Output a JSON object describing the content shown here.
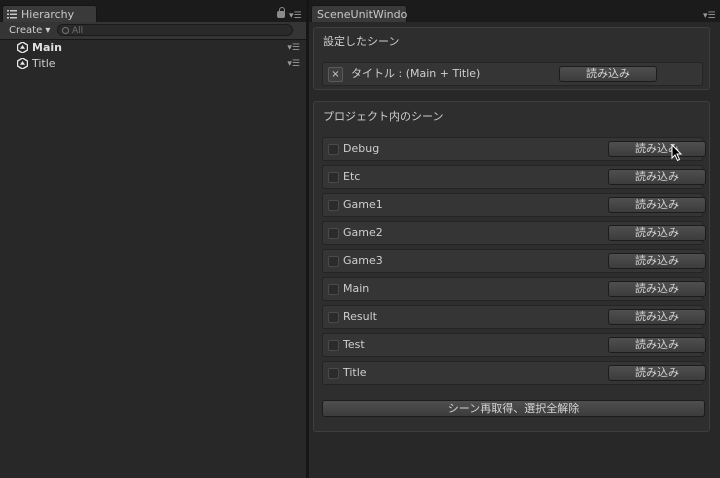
{
  "hierarchy": {
    "tab_title": "Hierarchy",
    "create_label": "Create",
    "search_placeholder": "All",
    "items": [
      {
        "label": "Main",
        "active": true
      },
      {
        "label": "Title",
        "active": false
      }
    ]
  },
  "scene_window": {
    "tab_title": "SceneUnitWindo",
    "configured_section_title": "設定したシーン",
    "configured": {
      "remove_label": "×",
      "label": "タイトル : (Main + Title)",
      "load_label": "読み込み"
    },
    "project_section_title": "プロジェクト内のシーン",
    "scenes": [
      {
        "name": "Debug",
        "load_label": "読み込み"
      },
      {
        "name": "Etc",
        "load_label": "読み込み"
      },
      {
        "name": "Game1",
        "load_label": "読み込み"
      },
      {
        "name": "Game2",
        "load_label": "読み込み"
      },
      {
        "name": "Game3",
        "load_label": "読み込み"
      },
      {
        "name": "Main",
        "load_label": "読み込み"
      },
      {
        "name": "Result",
        "load_label": "読み込み"
      },
      {
        "name": "Test",
        "load_label": "読み込み"
      },
      {
        "name": "Title",
        "load_label": "読み込み"
      }
    ],
    "refresh_button_label": "シーン再取得、選択全解除"
  }
}
